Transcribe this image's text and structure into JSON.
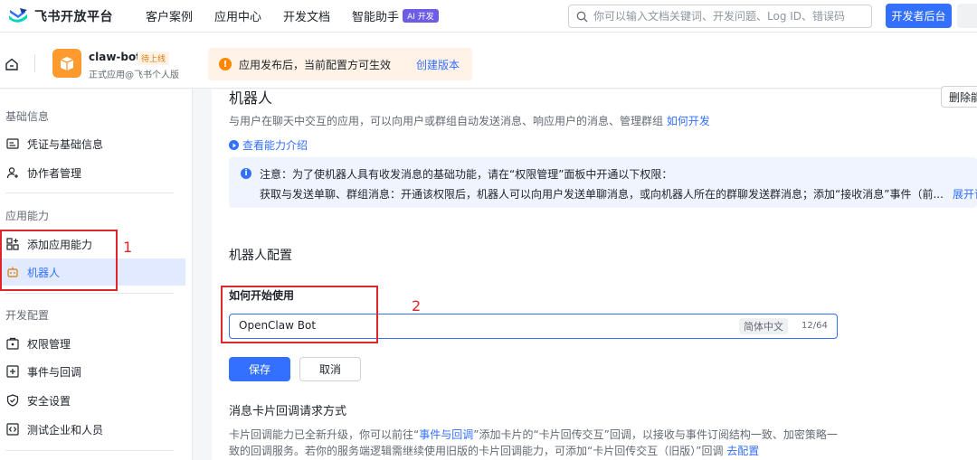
{
  "topnav": {
    "brand": "飞书开放平台",
    "items": [
      "客户案例",
      "应用中心",
      "开发文档",
      "智能助手"
    ],
    "ai_badge": "AI 开发",
    "search_placeholder": "你可以输入文档关键词、开发问题、Log ID、错误码",
    "dev_console": "开发者后台"
  },
  "appbar": {
    "app_name": "claw-bot",
    "app_status": "待上线",
    "app_sub": "正式应用@飞书个人版",
    "notice_text": "应用发布后，当前配置方可生效",
    "notice_link": "创建版本"
  },
  "sidebar": {
    "sections": [
      {
        "title": "基础信息",
        "items": [
          "凭证与基础信息",
          "协作者管理"
        ]
      },
      {
        "title": "应用能力",
        "items": [
          "添加应用能力",
          "机器人"
        ]
      },
      {
        "title": "开发配置",
        "items": [
          "权限管理",
          "事件与回调",
          "安全设置",
          "测试企业和人员"
        ]
      }
    ]
  },
  "main": {
    "title": "机器人",
    "desc": "与用户在聊天中交互的应用，可以向用户或群组自动发送消息、响应用户的消息、管理群组",
    "desc_link": "如何开发",
    "delete_btn": "删除能力",
    "cap_link": "查看能力介绍",
    "info_line1": "注意：为了使机器人具有收发消息的基础功能，请在“权限管理”面板中开通以下权限：",
    "info_line2": "获取与发送单聊、群组消息：开通该权限后，机器人可以向用户发送单聊消息，或向机器人所在的群聊发送群消息；添加“接收消息”事件（前...",
    "info_more": "展开详情",
    "config_title": "机器人配置",
    "field_label": "如何开始使用",
    "field_value": "OpenClaw Bot",
    "lang_tag": "简体中文",
    "count": "12/64",
    "save": "保存",
    "cancel": "取消",
    "callback_title": "消息卡片回调请求方式",
    "cb_l1_a": "卡片回调能力已全新升级，你可以前往“",
    "cb_l1_link": "事件与回调",
    "cb_l1_b": "”添加卡片的“卡片回传交互”回调，以接收与事件订阅结构一致、加密策略一",
    "cb_l2_a": "致的回调服务。若你的服务端逻辑需继续使用旧版的卡片回调能力，可添加“卡片回传交互（旧版）”回调",
    "cb_l2_link": "去配置"
  },
  "annotations": {
    "one": "1",
    "two": "2"
  },
  "colors": {
    "accent": "#3370ff",
    "annotation": "#e0262a",
    "app_icon": "#ff9a2e"
  }
}
